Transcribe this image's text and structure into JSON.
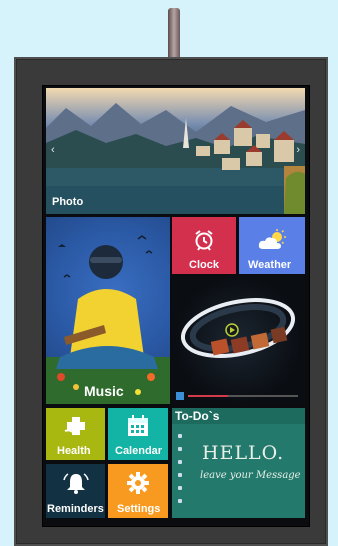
{
  "tiles": {
    "photo": {
      "label": "Photo"
    },
    "music": {
      "label": "Music"
    },
    "clock": {
      "label": "Clock"
    },
    "weather": {
      "label": "Weather"
    },
    "health": {
      "label": "Health"
    },
    "calendar": {
      "label": "Calendar"
    },
    "reminders": {
      "label": "Reminders"
    },
    "settings": {
      "label": "Settings"
    },
    "todo": {
      "title": "To-Do`s",
      "board_heading": "HELLO.",
      "board_subtext": "leave your Message"
    }
  },
  "photo_nav": {
    "prev": "‹",
    "next": "›"
  },
  "colors": {
    "background": "#d6f3fb",
    "frame": "#3a3a3a",
    "clock": "#d3304e",
    "weather": "#5a7fe6",
    "health": "#a9b711",
    "calendar": "#13b4a5",
    "reminders": "#123142",
    "settings": "#f89a1f",
    "todo": "#1d6a5e"
  },
  "icons": [
    "alarm-clock-icon",
    "weather-cloud-sun-icon",
    "health-plus-icon",
    "calendar-icon",
    "bell-icon",
    "gear-icon",
    "play-icon"
  ]
}
